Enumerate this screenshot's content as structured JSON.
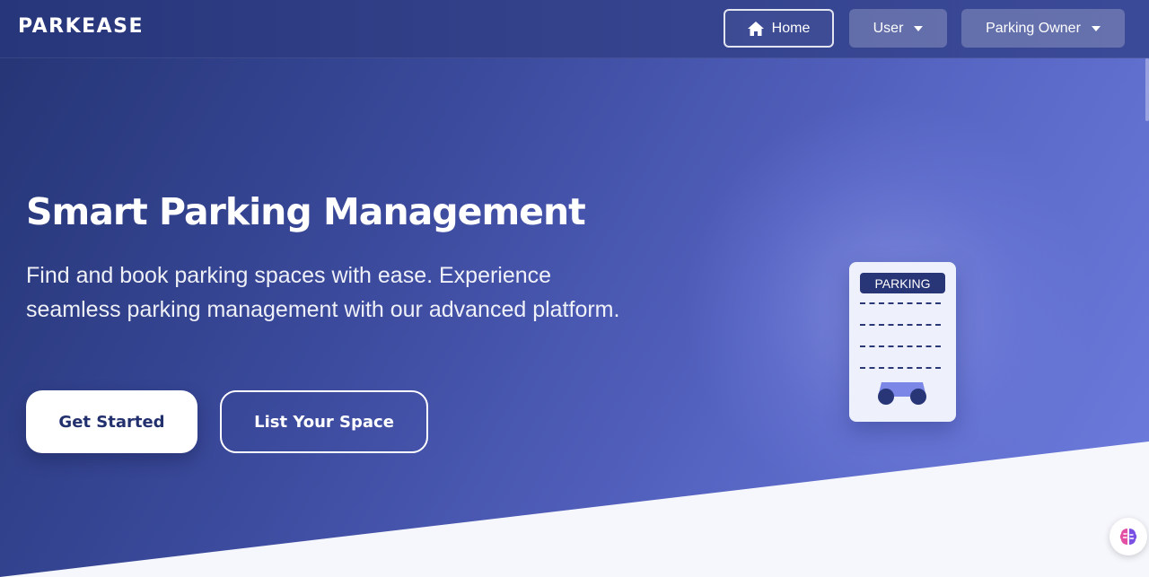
{
  "brand": {
    "name": "PARKEASE"
  },
  "nav": {
    "home_label": "Home",
    "user_label": "User",
    "owner_label": "Parking Owner",
    "home_icon": "home-icon",
    "dropdown_icon": "chevron-down-icon"
  },
  "hero": {
    "title": "Smart Parking Management",
    "subtitle": "Find and book parking spaces with ease. Experience seamless parking management with our advanced platform.",
    "primary_cta": "Get Started",
    "secondary_cta": "List Your Space"
  },
  "illustration": {
    "sign_label": "PARKING",
    "icon": "car-icon"
  },
  "floating": {
    "icon": "brain-icon"
  },
  "colors": {
    "navy": "#23306e",
    "accent": "#6f7ddf",
    "card_bg": "#eef0fb",
    "footer_bg": "#f6f7fc"
  }
}
